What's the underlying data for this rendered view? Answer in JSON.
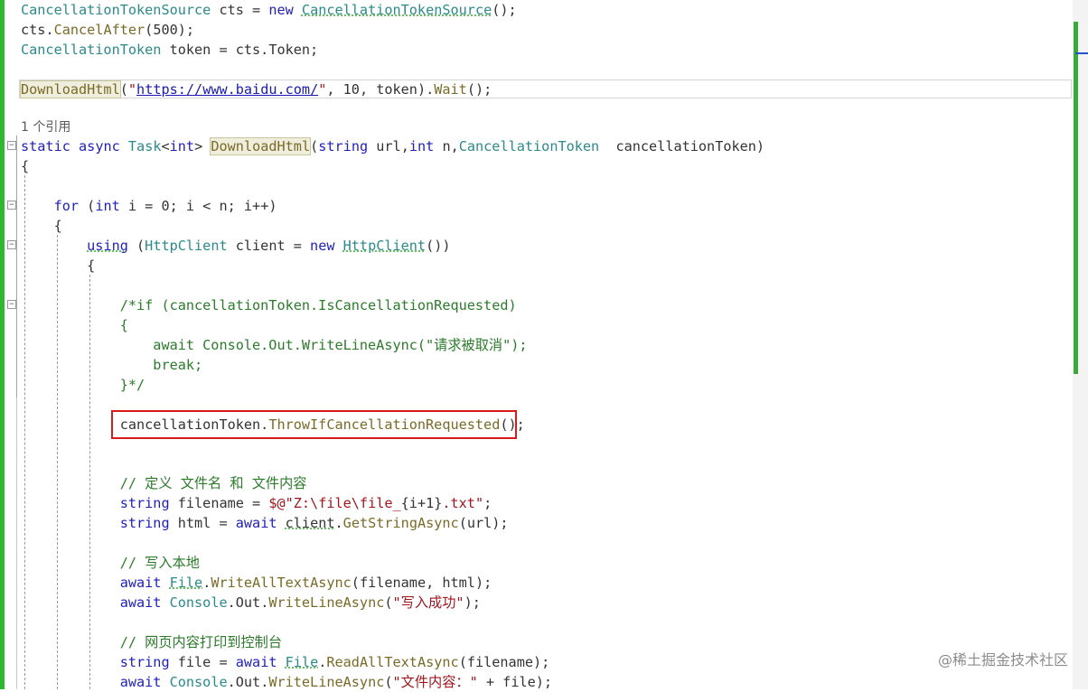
{
  "code_lines": [
    {
      "id": "l1",
      "text": "CancellationTokenSource cts = new CancellationTokenSource();"
    },
    {
      "id": "l2",
      "text": "cts.CancelAfter(500);"
    },
    {
      "id": "l3",
      "text": "CancellationToken token = cts.Token;"
    },
    {
      "id": "l4",
      "text": "DownloadHtml(\"https://www.baidu.com/\", 10, token).Wait();"
    },
    {
      "id": "l5",
      "text": "1 个引用"
    },
    {
      "id": "l6",
      "text": "static async Task<int> DownloadHtml(string url,int n,CancellationToken  cancellationToken)"
    },
    {
      "id": "l7",
      "text": "{"
    },
    {
      "id": "l8",
      "text": "    for (int i = 0; i < n; i++)"
    },
    {
      "id": "l9",
      "text": "    {"
    },
    {
      "id": "l10",
      "text": "        using (HttpClient client = new HttpClient())"
    },
    {
      "id": "l11",
      "text": "        {"
    },
    {
      "id": "l12",
      "text": "            /*if (cancellationToken.IsCancellationRequested)"
    },
    {
      "id": "l13",
      "text": "            {"
    },
    {
      "id": "l14",
      "text": "                await Console.Out.WriteLineAsync(\"请求被取消\");"
    },
    {
      "id": "l15",
      "text": "                break;"
    },
    {
      "id": "l16",
      "text": "            }*/"
    },
    {
      "id": "l17",
      "text": "            cancellationToken.ThrowIfCancellationRequested();"
    },
    {
      "id": "l18",
      "text": "            // 定义 文件名 和 文件内容"
    },
    {
      "id": "l19",
      "text": "            string filename = $@\"Z:\\file\\file_{i+1}.txt\";"
    },
    {
      "id": "l20",
      "text": "            string html = await client.GetStringAsync(url);"
    },
    {
      "id": "l21",
      "text": "            // 写入本地"
    },
    {
      "id": "l22",
      "text": "            await File.WriteAllTextAsync(filename, html);"
    },
    {
      "id": "l23",
      "text": "            await Console.Out.WriteLineAsync(\"写入成功\");"
    },
    {
      "id": "l24",
      "text": "            // 网页内容打印到控制台"
    },
    {
      "id": "l25",
      "text": "            string file = await File.ReadAllTextAsync(filename);"
    },
    {
      "id": "l26",
      "text": "            await Console.Out.WriteLineAsync(\"文件内容：\" + file);"
    }
  ],
  "watermark": "@稀土掘金技术社区",
  "colors": {
    "keyword": "#1f1fbf",
    "type": "#2b8a8a",
    "method": "#7a6a28",
    "string": "#a3151e",
    "comment": "#2b7b2b",
    "accent_green": "#2db82d",
    "highlight_box": "#d91a1a"
  }
}
